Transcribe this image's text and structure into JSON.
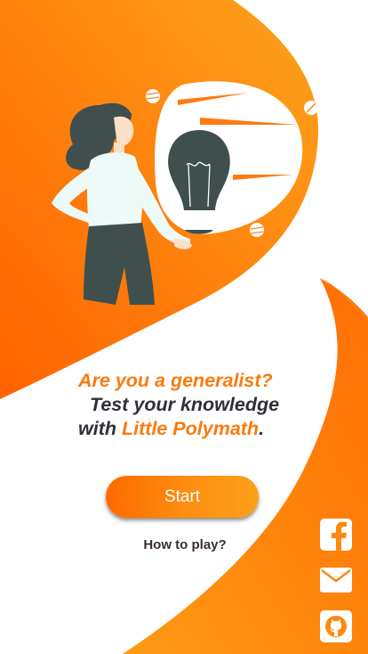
{
  "tagline": {
    "line1": "Are you a generalist?",
    "line2": "Test your knowledge",
    "line3_prefix": "with ",
    "line3_app": "Little Polymath",
    "line3_suffix": "."
  },
  "actions": {
    "start_label": "Start",
    "howto_label": "How to play?"
  },
  "social": [
    {
      "icon": "facebook-icon"
    },
    {
      "icon": "mail-icon"
    },
    {
      "icon": "github-icon"
    }
  ],
  "colors": {
    "accent": "#fb7a0e",
    "orange_dark": "#ff6a00",
    "orange_light": "#fba11a",
    "text_dark": "#2f2f38"
  }
}
